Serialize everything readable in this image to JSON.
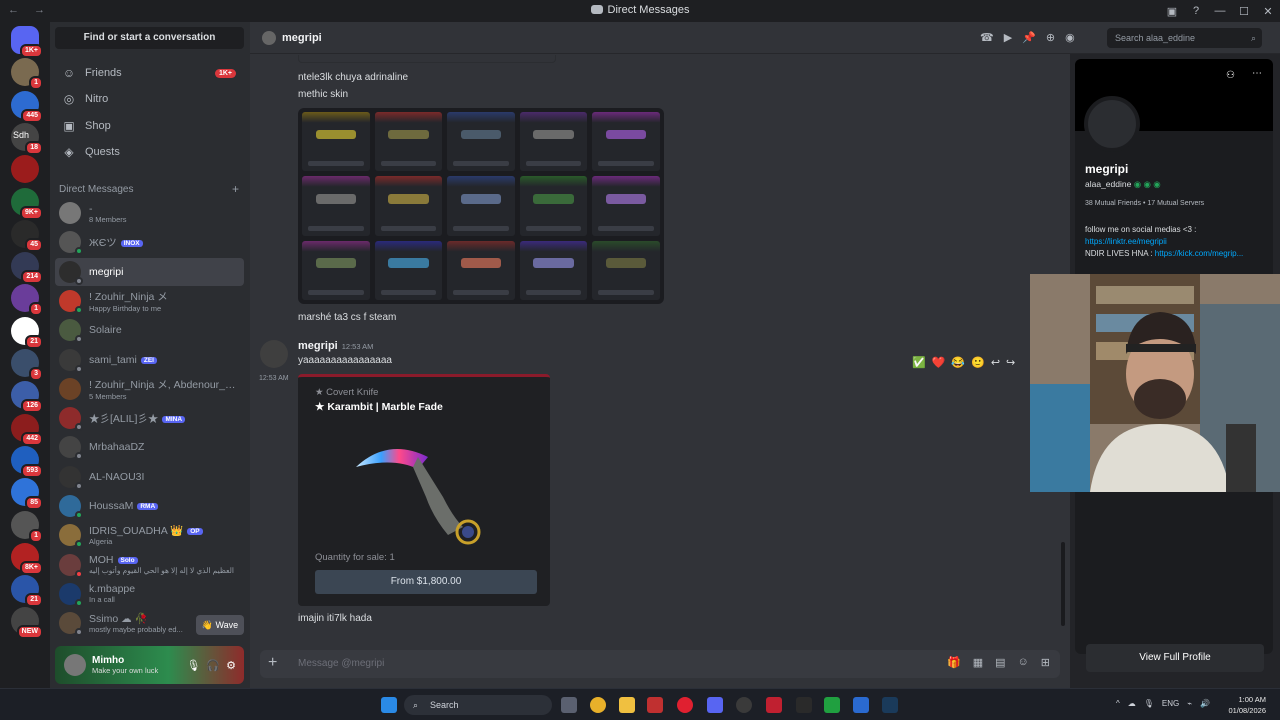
{
  "window": {
    "title": "Direct Messages",
    "nav": "← →",
    "controls": [
      "▣",
      "?",
      "—",
      "☐",
      "✕"
    ]
  },
  "servers": [
    {
      "badge": "1K+",
      "color": "#5865f2"
    },
    {
      "badge": "1",
      "color": "#7a6a50"
    },
    {
      "badge": "445",
      "color": "#2d6bd1"
    },
    {
      "badge": "18",
      "color": "#444",
      "label": "Sdh"
    },
    {
      "badge": "",
      "color": "#9b1c1c"
    },
    {
      "badge": "9K+",
      "color": "#1f6b3a"
    },
    {
      "badge": "45",
      "color": "#2a2a2a"
    },
    {
      "badge": "214",
      "color": "#333a55"
    },
    {
      "badge": "1",
      "color": "#6a3d9a"
    },
    {
      "badge": "21",
      "color": "#ffffff"
    },
    {
      "badge": "3",
      "color": "#3a4e6b"
    },
    {
      "badge": "126",
      "color": "#3c5ea8"
    },
    {
      "badge": "442",
      "color": "#8c1d1d"
    },
    {
      "badge": "593",
      "color": "#1f5fbf"
    },
    {
      "badge": "85",
      "color": "#2f73d9"
    },
    {
      "badge": "1",
      "color": "#555"
    },
    {
      "badge": "8K+",
      "color": "#b22222"
    },
    {
      "badge": "21",
      "color": "#2a55a8"
    },
    {
      "badge": "NEW",
      "color": "#444"
    }
  ],
  "sidebar": {
    "find": "Find or start a conversation",
    "nav": [
      {
        "label": "Friends",
        "icon": "friends-icon",
        "badge": "1K+"
      },
      {
        "label": "Nitro",
        "icon": "nitro-icon",
        "badge": ""
      },
      {
        "label": "Shop",
        "icon": "shop-icon",
        "badge": ""
      },
      {
        "label": "Quests",
        "icon": "quests-icon",
        "badge": ""
      }
    ],
    "dm_header": "Direct Messages",
    "dm_add": "+",
    "dms": [
      {
        "name": "-",
        "sub": "8 Members",
        "tag": "",
        "color": "#777",
        "status": ""
      },
      {
        "name": "ЖЄツ",
        "sub": "",
        "tag": "INOX",
        "color": "#555",
        "status": "#23a55a"
      },
      {
        "name": "megripi",
        "sub": "",
        "tag": "",
        "color": "#2d2d2d",
        "status": "#80848e"
      },
      {
        "name": "! Zouhir_Ninja メ",
        "sub": "Happy Birthday to me",
        "tag": "",
        "color": "#c0392b",
        "status": "#23a55a"
      },
      {
        "name": "Solaire",
        "sub": "",
        "tag": "",
        "color": "#4a5a40",
        "status": "#80848e"
      },
      {
        "name": "sami_tami",
        "sub": "",
        "tag": "ZEI",
        "color": "#3a3a3a",
        "status": "#80848e"
      },
      {
        "name": "! Zouhir_Ninja メ, Abdenour_War...",
        "sub": "5 Members",
        "tag": "",
        "color": "#6b4226",
        "status": ""
      },
      {
        "name": "★彡[ALIL]彡★",
        "sub": "",
        "tag": "MINA",
        "color": "#8e2b2b",
        "status": "#80848e"
      },
      {
        "name": "MrbahaaDZ",
        "sub": "",
        "tag": "",
        "color": "#444",
        "status": "#80848e"
      },
      {
        "name": "AL-NAOU3I",
        "sub": "",
        "tag": "",
        "color": "#333",
        "status": "#80848e"
      },
      {
        "name": "HoussaM",
        "sub": "",
        "tag": "RMA",
        "color": "#2f6a9a",
        "status": "#23a55a"
      },
      {
        "name": "IDRIS_OUADHA 👑",
        "sub": "Algeria",
        "tag": "OP",
        "color": "#8a6d3b",
        "status": "#23a55a"
      },
      {
        "name": "MOH",
        "sub": "العظيم الذي لا إله إلا هو الحي القيوم وأتوب إليه",
        "tag": "Solo",
        "color": "#6a3d3d",
        "status": "#f23f43"
      },
      {
        "name": "k.mbappe",
        "sub": "In a call",
        "tag": "",
        "color": "#1b3a6b",
        "status": "#23a55a"
      },
      {
        "name": "Ssimo ☁ 🥀",
        "sub": "mostly maybe probably ed...",
        "tag": "",
        "color": "#5a4a3a",
        "status": "#80848e"
      }
    ],
    "wave": "👋 Wave",
    "user": {
      "name": "Mimho",
      "status": "Make your own luck"
    }
  },
  "chat": {
    "recipient": "megripi",
    "search_placeholder": "Search alaa_eddine",
    "messages_pre": [
      "ntele3lk chuya adrinaline",
      "methic skin"
    ],
    "grid_caption": "marshé ta3 cs f steam",
    "author": "megripi",
    "time": "12:53 AM",
    "side_time": "12:53 AM",
    "text": "yaaaaaaaaaaaaaaaa",
    "reactions": [
      "✅",
      "❤️",
      "😂",
      "🙂",
      "↩",
      "↪"
    ],
    "card": {
      "type": "★ Covert Knife",
      "name": "★ Karambit | Marble Fade",
      "qty": "Quantity for sale: 1",
      "button": "From $1,800.00"
    },
    "last": "imajin iti7lk hada",
    "composer": "Message @megripi"
  },
  "grid_colors": [
    [
      "#9a8f2f",
      "#6e6a3e",
      "#4a5a6a",
      "#6a6a6a",
      "#7a4aa0"
    ],
    [
      "#6a6a6a",
      "#8a7a3a",
      "#5a6a8a",
      "#3a6a3a",
      "#7a5aa0"
    ],
    [
      "#5a6a4a",
      "#3a7aa0",
      "#a05a4a",
      "#6a6aa0",
      "#5a5a3a"
    ]
  ],
  "grid_accents": [
    [
      "#6a5a1a",
      "#7a2a2a",
      "#2a3a6a",
      "#4a2a6a",
      "#6a2a7a"
    ],
    [
      "#6a2a6a",
      "#7a2a2a",
      "#2a3a6a",
      "#2a5a2a",
      "#6a2a7a"
    ],
    [
      "#6a2a6a",
      "#2a2a7a",
      "#6a2a2a",
      "#3a2a7a",
      "#2a4a2a"
    ]
  ],
  "profile": {
    "name": "megripi",
    "username": "alaa_eddine",
    "mutual": "38 Mutual Friends • 17 Mutual Servers",
    "bio1": "follow me on social medias <3 :",
    "link1": "https://linktr.ee/megripii",
    "bio2_label": "NDIR LIVES HNA : ",
    "link2": "https://kick.com/megrip...",
    "view": "View Full Profile"
  },
  "taskbar": {
    "search": "Search",
    "lang": "ENG",
    "time": "1:00 AM",
    "date": "01/08/2026"
  }
}
